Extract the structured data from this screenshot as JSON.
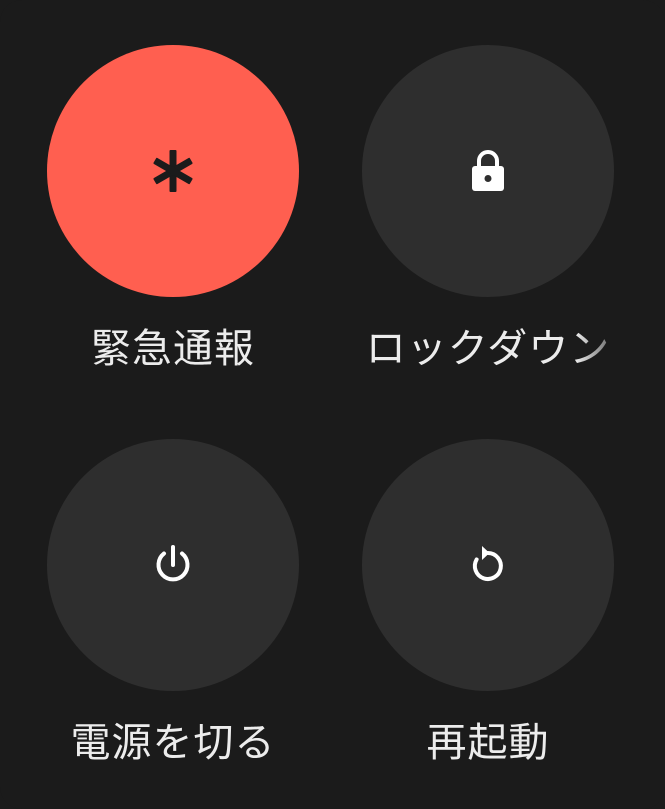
{
  "power_menu": {
    "buttons": [
      {
        "id": "emergency",
        "label": "緊急通報",
        "icon": "asterisk-icon",
        "color": "#ff5f50"
      },
      {
        "id": "lockdown",
        "label": "ロックダウン",
        "icon": "lock-icon",
        "color": "#2e2e2e"
      },
      {
        "id": "power_off",
        "label": "電源を切る",
        "icon": "power-icon",
        "color": "#2e2e2e"
      },
      {
        "id": "restart",
        "label": "再起動",
        "icon": "restart-icon",
        "color": "#2e2e2e"
      }
    ]
  }
}
